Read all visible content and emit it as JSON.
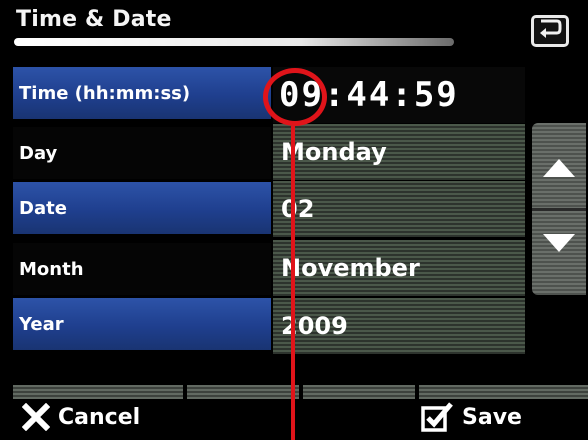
{
  "header": {
    "title": "Time & Date"
  },
  "rows": [
    {
      "label": "Time (hh:mm:ss)",
      "value": "09:44:59"
    },
    {
      "label": "Day",
      "value": "Monday"
    },
    {
      "label": "Date",
      "value": "02"
    },
    {
      "label": "Month",
      "value": "November"
    },
    {
      "label": "Year",
      "value": "2009"
    }
  ],
  "footer": {
    "cancel_label": "Cancel",
    "save_label": "Save"
  },
  "icons": {
    "back": "return-arrow-icon",
    "up": "triangle-up-icon",
    "down": "triangle-down-icon",
    "cancel": "x-icon",
    "save": "checkbox-check-icon"
  },
  "colors": {
    "label_blue": "#2d53a8",
    "annotation_red": "#e0141a",
    "value_stripe": "#4b584a"
  }
}
